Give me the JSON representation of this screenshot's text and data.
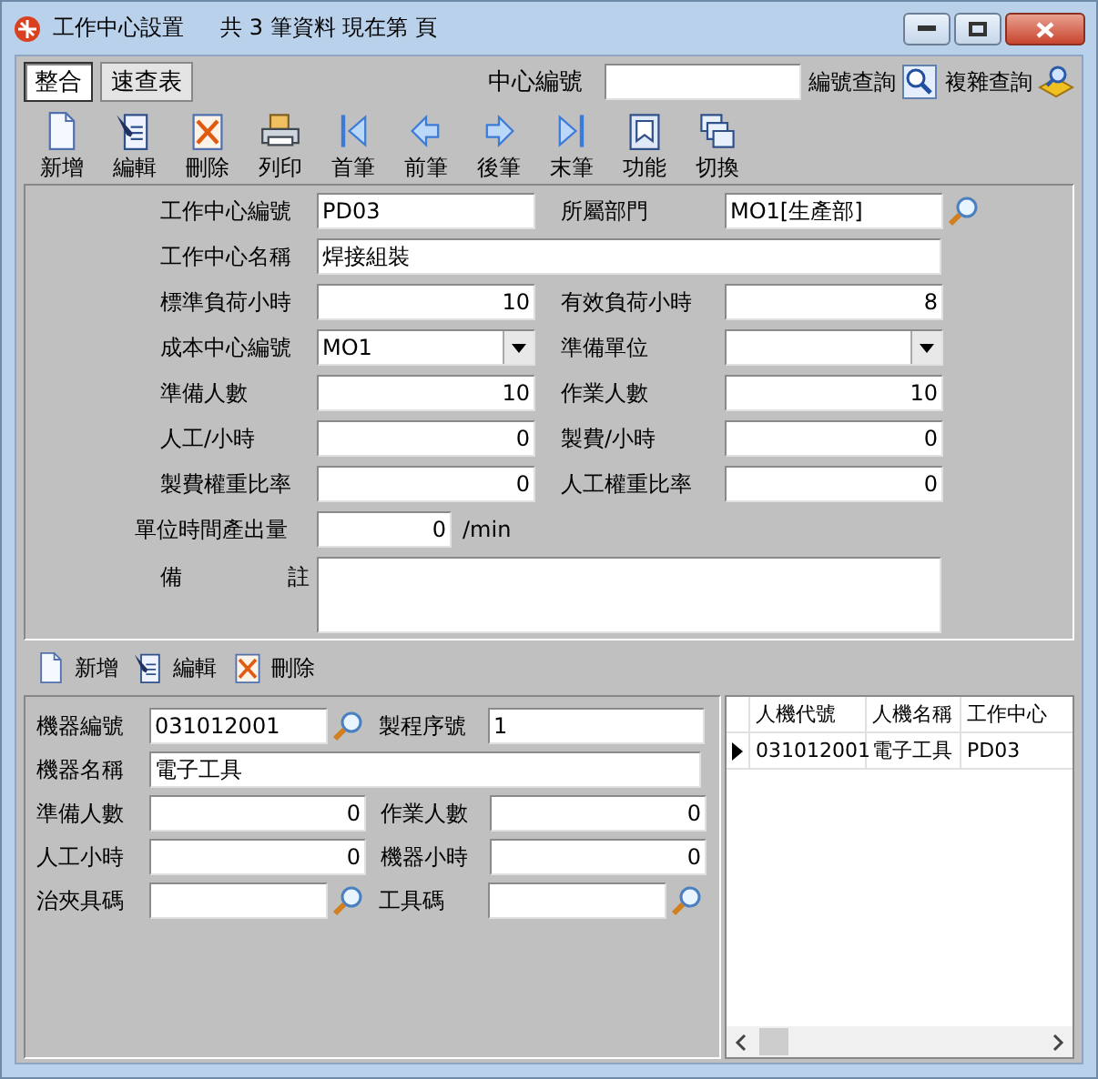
{
  "window": {
    "title": "工作中心設置",
    "info": "共 3 筆資料  現在第 頁"
  },
  "tabs": [
    {
      "label": "整合",
      "selected": true
    },
    {
      "label": "速查表",
      "selected": false
    }
  ],
  "search": {
    "label": "中心編號",
    "buttons": [
      {
        "label": "編號查詢",
        "kind": "search"
      },
      {
        "label": "複雜查詢",
        "kind": "query"
      }
    ]
  },
  "toolbar": [
    {
      "label": "新增",
      "kind": "new"
    },
    {
      "label": "編輯",
      "kind": "edit"
    },
    {
      "label": "刪除",
      "kind": "delete"
    },
    {
      "label": "列印",
      "kind": "print"
    },
    {
      "label": "首筆",
      "kind": "first"
    },
    {
      "label": "前筆",
      "kind": "prev"
    },
    {
      "label": "後筆",
      "kind": "next"
    },
    {
      "label": "末筆",
      "kind": "last"
    },
    {
      "label": "功能",
      "kind": "function"
    },
    {
      "label": "切換",
      "kind": "switch"
    }
  ],
  "form": {
    "rows": [
      [
        {
          "label": "工作中心編號",
          "kind": "text",
          "value": "PD03"
        },
        {
          "label": "所屬部門",
          "kind": "lookup",
          "value": "MO1[生產部]"
        }
      ],
      [
        {
          "label": "工作中心名稱",
          "kind": "wide",
          "value": "焊接組裝"
        }
      ],
      [
        {
          "label": "標準負荷小時",
          "kind": "number",
          "value": "10"
        },
        {
          "label": "有效負荷小時",
          "kind": "number",
          "value": "8"
        }
      ],
      [
        {
          "label": "成本中心編號",
          "kind": "select",
          "value": "MO1"
        },
        {
          "label": "準備單位",
          "kind": "select"
        }
      ],
      [
        {
          "label": "準備人數",
          "kind": "number",
          "value": "10"
        },
        {
          "label": "作業人數",
          "kind": "number",
          "value": "10"
        }
      ],
      [
        {
          "label": "人工/小時",
          "kind": "number",
          "value": "0"
        },
        {
          "label": "製費/小時",
          "kind": "number",
          "value": "0"
        }
      ],
      [
        {
          "label": "製費權重比率",
          "kind": "number",
          "value": "0"
        },
        {
          "label": "人工權重比率",
          "kind": "number",
          "value": "0"
        }
      ],
      [
        {
          "label": "單位時間產出量",
          "kind": "unit",
          "value": "0",
          "unit": "/min"
        }
      ],
      [
        {
          "label": "備註",
          "kind": "memo"
        }
      ]
    ]
  },
  "detail_toolbar": [
    {
      "label": "新增",
      "kind": "new"
    },
    {
      "label": "編輯",
      "kind": "edit"
    },
    {
      "label": "刪除",
      "kind": "delete"
    }
  ],
  "detail_form": {
    "rows": [
      [
        {
          "label": "機器編號",
          "kind": "lookup",
          "value": "031012001"
        },
        {
          "label": "製程序號",
          "kind": "text",
          "value": "1"
        }
      ],
      [
        {
          "label": "機器名稱",
          "kind": "wide",
          "value": "電子工具"
        }
      ],
      [
        {
          "label": "準備人數",
          "kind": "number",
          "value": "0"
        },
        {
          "label": "作業人數",
          "kind": "number",
          "value": "0"
        }
      ],
      [
        {
          "label": "人工小時",
          "kind": "number",
          "value": "0"
        },
        {
          "label": "機器小時",
          "kind": "number",
          "value": "0"
        }
      ],
      [
        {
          "label": "治夾具碼",
          "kind": "lookup"
        },
        {
          "label": "工具碼",
          "kind": "lookup"
        }
      ]
    ]
  },
  "table": {
    "columns": [
      "人機代號",
      "人機名稱",
      "工作中心"
    ],
    "rows": [
      {
        "cells": [
          "031012001",
          "電子工具",
          "PD03"
        ],
        "selected": true
      }
    ]
  }
}
